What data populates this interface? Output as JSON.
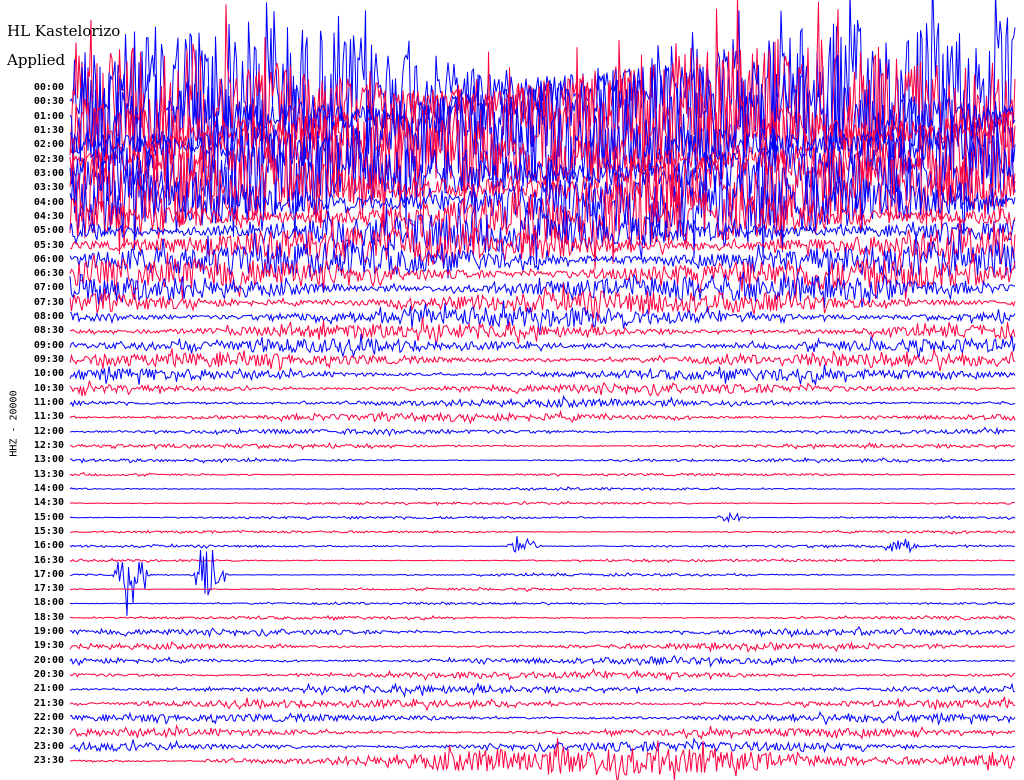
{
  "chart_data": {
    "type": "line",
    "title": "HL Kastelorizo",
    "subtitle": "Applied",
    "ylabel": "HHZ - 20000",
    "row_labels": [
      "00:00",
      "00:30",
      "01:00",
      "01:30",
      "02:00",
      "02:30",
      "03:00",
      "03:30",
      "04:00",
      "04:30",
      "05:00",
      "05:30",
      "06:00",
      "06:30",
      "07:00",
      "07:30",
      "08:00",
      "08:30",
      "09:00",
      "09:30",
      "10:00",
      "10:30",
      "11:00",
      "11:30",
      "12:00",
      "12:30",
      "13:00",
      "13:30",
      "14:00",
      "14:30",
      "15:00",
      "15:30",
      "16:00",
      "16:30",
      "17:00",
      "17:30",
      "18:00",
      "18:30",
      "19:00",
      "19:30",
      "20:00",
      "20:30",
      "21:00",
      "21:30",
      "22:00",
      "22:30",
      "23:00",
      "23:30"
    ],
    "row_amplitude": [
      70,
      65,
      60,
      55,
      50,
      48,
      44,
      40,
      36,
      30,
      22,
      20,
      18,
      16,
      14,
      12,
      10,
      8,
      7,
      7,
      6,
      5,
      4,
      4,
      2.5,
      2,
      1.5,
      1.2,
      1.2,
      1.2,
      1.2,
      1.2,
      1.2,
      1.2,
      1.2,
      1.2,
      1.2,
      1.5,
      3,
      3,
      3.5,
      3.5,
      4,
      4,
      4,
      4,
      5,
      14
    ],
    "events": [
      {
        "row": 32,
        "time_fraction": 0.48,
        "amplitude": 10
      },
      {
        "row": 32,
        "time_fraction": 0.88,
        "amplitude": 9
      },
      {
        "row": 34,
        "time_fraction": 0.065,
        "amplitude": 30
      },
      {
        "row": 34,
        "time_fraction": 0.148,
        "amplitude": 30
      },
      {
        "row": 30,
        "time_fraction": 0.7,
        "amplitude": 5
      }
    ],
    "colors": {
      "even": "#0000ff",
      "odd": "#ff0040"
    }
  }
}
